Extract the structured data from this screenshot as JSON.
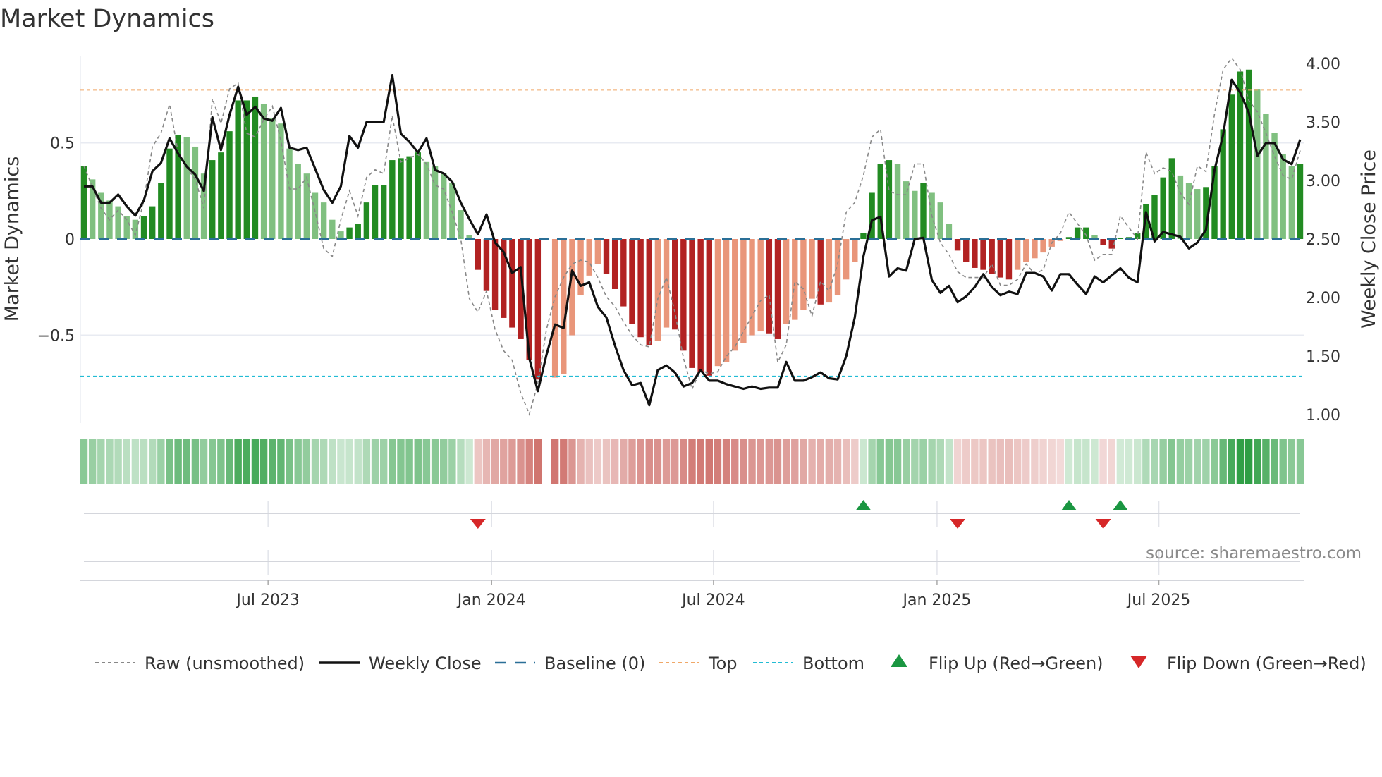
{
  "title": "Market Dynamics",
  "source": "source: sharemaestro.com",
  "colors": {
    "pos_strong": "#228B22",
    "pos_weak": "#80c080",
    "neg_strong": "#b22222",
    "neg_weak": "#e9967a",
    "close": "#111111",
    "raw": "#888888",
    "baseline": "#2a6f97",
    "top": "#f0a868",
    "bottom": "#22bcd4",
    "flip_up": "#1a9641",
    "flip_down": "#d62728",
    "strip_pos": "#2e9e44",
    "strip_neg": "#c9605a"
  },
  "chart_data": {
    "type": "bar",
    "title": "Market Dynamics",
    "ylabel": "Market Dynamics",
    "y2label": "Weekly Close Price",
    "ylim": [
      -0.95,
      0.95
    ],
    "y2lim": [
      1.0,
      4.0
    ],
    "yticks": [
      {
        "v": 0.5,
        "label": "0.5"
      },
      {
        "v": 0,
        "label": "0"
      },
      {
        "v": -0.5,
        "label": "−0.5"
      }
    ],
    "y2ticks": [
      {
        "v": 4.0,
        "label": "4.00"
      },
      {
        "v": 3.5,
        "label": "3.50"
      },
      {
        "v": 3.0,
        "label": "3.00"
      },
      {
        "v": 2.5,
        "label": "2.50"
      },
      {
        "v": 2.0,
        "label": "2.00"
      },
      {
        "v": 1.5,
        "label": "1.50"
      },
      {
        "v": 1.0,
        "label": "1.00"
      }
    ],
    "xticks": [
      {
        "week": 21.5,
        "label": "Jul 2023"
      },
      {
        "week": 47.6,
        "label": "Jan 2024"
      },
      {
        "week": 73.5,
        "label": "Jul 2024"
      },
      {
        "week": 99.6,
        "label": "Jan 2025"
      },
      {
        "week": 125.5,
        "label": "Jul 2025"
      }
    ],
    "x_unit": "week index (weekly, ~Feb 2023 to Oct 2025)",
    "top_level": 0.775,
    "bottom_level": -0.714,
    "baseline": 0,
    "momentum": [
      0.38,
      0.31,
      0.24,
      0.2,
      0.17,
      0.12,
      0.1,
      0.12,
      0.17,
      0.29,
      0.47,
      0.54,
      0.53,
      0.48,
      0.34,
      0.41,
      0.45,
      0.56,
      0.72,
      0.72,
      0.74,
      0.7,
      0.63,
      0.6,
      0.47,
      0.39,
      0.34,
      0.24,
      0.19,
      0.1,
      0.04,
      0.06,
      0.08,
      0.19,
      0.28,
      0.28,
      0.41,
      0.42,
      0.43,
      0.45,
      0.4,
      0.38,
      0.34,
      0.29,
      0.15,
      0.02,
      -0.16,
      -0.27,
      -0.37,
      -0.41,
      -0.46,
      -0.52,
      -0.63,
      -0.73,
      null,
      -0.72,
      -0.7,
      -0.5,
      -0.29,
      -0.19,
      -0.13,
      -0.18,
      -0.26,
      -0.35,
      -0.44,
      -0.51,
      -0.55,
      -0.53,
      -0.46,
      -0.47,
      -0.58,
      -0.67,
      -0.69,
      -0.71,
      -0.66,
      -0.64,
      -0.58,
      -0.54,
      -0.5,
      -0.48,
      -0.49,
      -0.52,
      -0.44,
      -0.42,
      -0.37,
      -0.31,
      -0.34,
      -0.33,
      -0.29,
      -0.21,
      -0.12,
      0.03,
      0.24,
      0.39,
      0.41,
      0.39,
      0.3,
      0.25,
      0.29,
      0.24,
      0.19,
      0.08,
      -0.06,
      -0.12,
      -0.15,
      -0.16,
      -0.18,
      -0.2,
      -0.21,
      -0.16,
      -0.12,
      -0.1,
      -0.07,
      -0.04,
      -0.01,
      0.01,
      0.06,
      0.06,
      0.02,
      -0.03,
      -0.05,
      0.005,
      0.01,
      0.03,
      0.18,
      0.23,
      0.32,
      0.42,
      0.33,
      0.29,
      0.26,
      0.27,
      0.38,
      0.57,
      0.75,
      0.87,
      0.88,
      0.78,
      0.65,
      0.55,
      0.44,
      0.38,
      0.39
    ],
    "raw": [
      0.38,
      0.27,
      0.16,
      0.1,
      0.15,
      0.1,
      0.02,
      0.2,
      0.48,
      0.55,
      0.7,
      0.45,
      0.37,
      0.31,
      0.16,
      0.73,
      0.6,
      0.78,
      0.81,
      0.55,
      0.53,
      0.62,
      0.69,
      0.51,
      0.26,
      0.26,
      0.32,
      0.14,
      -0.05,
      -0.09,
      0.1,
      0.25,
      0.12,
      0.32,
      0.36,
      0.34,
      0.64,
      0.4,
      0.42,
      0.44,
      0.39,
      0.28,
      0.26,
      0.14,
      0.0,
      -0.31,
      -0.38,
      -0.27,
      -0.47,
      -0.58,
      -0.63,
      -0.8,
      -0.91,
      -0.75,
      -0.47,
      -0.3,
      -0.2,
      -0.13,
      -0.11,
      -0.12,
      -0.2,
      -0.3,
      -0.35,
      -0.43,
      -0.5,
      -0.55,
      -0.56,
      -0.31,
      -0.2,
      -0.38,
      -0.62,
      -0.78,
      -0.68,
      -0.7,
      -0.69,
      -0.61,
      -0.56,
      -0.48,
      -0.4,
      -0.32,
      -0.29,
      -0.64,
      -0.55,
      -0.22,
      -0.26,
      -0.4,
      -0.22,
      -0.27,
      -0.13,
      0.14,
      0.19,
      0.33,
      0.53,
      0.57,
      0.25,
      0.23,
      0.23,
      0.39,
      0.39,
      0.12,
      -0.02,
      -0.08,
      -0.17,
      -0.2,
      -0.2,
      -0.2,
      -0.13,
      -0.24,
      -0.24,
      -0.21,
      -0.13,
      -0.18,
      -0.16,
      -0.02,
      0.03,
      0.14,
      0.08,
      0.02,
      -0.11,
      -0.08,
      -0.08,
      0.12,
      0.06,
      0.0,
      0.45,
      0.34,
      0.37,
      0.35,
      0.24,
      0.18,
      0.38,
      0.35,
      0.65,
      0.88,
      0.94,
      0.88,
      0.72,
      0.66,
      0.55,
      0.43,
      0.33,
      0.31,
      0.46
    ],
    "close": [
      2.95,
      2.95,
      2.81,
      2.81,
      2.88,
      2.78,
      2.7,
      2.83,
      3.08,
      3.15,
      3.36,
      3.23,
      3.12,
      3.05,
      2.91,
      3.54,
      3.26,
      3.56,
      3.8,
      3.56,
      3.63,
      3.53,
      3.51,
      3.62,
      3.28,
      3.26,
      3.28,
      3.1,
      2.92,
      2.81,
      2.95,
      3.38,
      3.28,
      3.5,
      3.5,
      3.5,
      3.9,
      3.4,
      3.33,
      3.24,
      3.36,
      3.09,
      3.06,
      2.99,
      2.81,
      2.67,
      2.54,
      2.71,
      2.47,
      2.39,
      2.21,
      2.26,
      1.48,
      1.2,
      1.51,
      1.77,
      1.74,
      2.23,
      2.1,
      2.13,
      1.92,
      1.83,
      1.59,
      1.38,
      1.25,
      1.27,
      1.08,
      1.38,
      1.42,
      1.36,
      1.24,
      1.27,
      1.38,
      1.29,
      1.29,
      1.26,
      1.24,
      1.22,
      1.24,
      1.22,
      1.23,
      1.23,
      1.45,
      1.29,
      1.29,
      1.32,
      1.36,
      1.31,
      1.3,
      1.5,
      1.83,
      2.35,
      2.66,
      2.69,
      2.18,
      2.25,
      2.23,
      2.5,
      2.51,
      2.15,
      2.04,
      2.1,
      1.96,
      2.01,
      2.09,
      2.2,
      2.09,
      2.02,
      2.05,
      2.03,
      2.21,
      2.21,
      2.18,
      2.06,
      2.2,
      2.2,
      2.11,
      2.03,
      2.18,
      2.13,
      2.19,
      2.25,
      2.17,
      2.13,
      2.73,
      2.48,
      2.56,
      2.54,
      2.52,
      2.42,
      2.47,
      2.58,
      3.09,
      3.39,
      3.86,
      3.75,
      3.58,
      3.21,
      3.32,
      3.32,
      3.18,
      3.14,
      3.35
    ],
    "legend": {
      "placement": "bottom",
      "items": [
        {
          "key": "raw",
          "label": "Raw (unsmoothed)"
        },
        {
          "key": "close",
          "label": "Weekly Close"
        },
        {
          "key": "baseline",
          "label": "Baseline (0)"
        },
        {
          "key": "top",
          "label": "Top"
        },
        {
          "key": "bottom",
          "label": "Bottom"
        },
        {
          "key": "flip_up",
          "label": "Flip Up (Red→Green)"
        },
        {
          "key": "flip_down",
          "label": "Flip Down (Green→Red)"
        }
      ]
    }
  }
}
